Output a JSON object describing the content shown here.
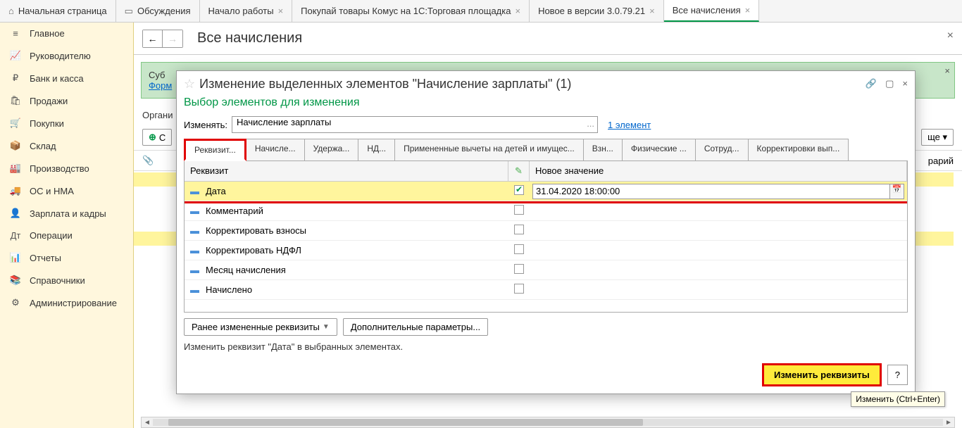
{
  "topTabs": {
    "home": "Начальная страница",
    "discuss": "Обсуждения",
    "t1": "Начало работы",
    "t2": "Покупай товары Комус на 1С:Торговая площадка",
    "t3": "Новое в версии 3.0.79.21",
    "active": "Все начисления"
  },
  "sidebar": {
    "items": [
      {
        "icon": "≡",
        "label": "Главное"
      },
      {
        "icon": "📈",
        "label": "Руководителю"
      },
      {
        "icon": "₽",
        "label": "Банк и касса"
      },
      {
        "icon": "🛍",
        "label": "Продажи"
      },
      {
        "icon": "🛒",
        "label": "Покупки"
      },
      {
        "icon": "📦",
        "label": "Склад"
      },
      {
        "icon": "🏭",
        "label": "Производство"
      },
      {
        "icon": "🚚",
        "label": "ОС и НМА"
      },
      {
        "icon": "👤",
        "label": "Зарплата и кадры"
      },
      {
        "icon": "Дт",
        "label": "Операции"
      },
      {
        "icon": "📊",
        "label": "Отчеты"
      },
      {
        "icon": "📚",
        "label": "Справочники"
      },
      {
        "icon": "⚙",
        "label": "Администрирование"
      }
    ]
  },
  "page": {
    "title": "Все начисления",
    "infoTitle": "Суб",
    "infoLink": "Форм",
    "orgLabel": "Органи",
    "createLabel": "С",
    "moreLabel": "ще ▾",
    "rightLabel": "рарий"
  },
  "dialog": {
    "title": "Изменение выделенных элементов \"Начисление зарплаты\" (1)",
    "subtitle": "Выбор элементов для изменения",
    "changeLabel": "Изменять:",
    "changeValue": "Начисление зарплаты",
    "countLink": "1 элемент",
    "tabs": [
      "Реквизит...",
      "Начисле...",
      "Удержа...",
      "НД...",
      "Примененные вычеты на детей и имущес...",
      "Взн...",
      "Физические ...",
      "Сотруд...",
      "Корректировки вып..."
    ],
    "gridHead": {
      "c1": "Реквизит",
      "c3": "Новое значение"
    },
    "rows": [
      {
        "label": "Дата",
        "checked": true,
        "value": "31.04.2020 18:00:00",
        "hl": true,
        "date": true
      },
      {
        "label": "Комментарий",
        "checked": false
      },
      {
        "label": "Корректировать взносы",
        "checked": false
      },
      {
        "label": "Корректировать НДФЛ",
        "checked": false
      },
      {
        "label": "Месяц начисления",
        "checked": false
      },
      {
        "label": "Начислено",
        "checked": false
      }
    ],
    "prevBtn": "Ранее измененные реквизиты",
    "addBtn": "Дополнительные параметры...",
    "status": "Изменить реквизит \"Дата\" в выбранных элементах.",
    "primary": "Изменить реквизиты",
    "help": "?",
    "tooltip": "Изменить (Ctrl+Enter)"
  }
}
